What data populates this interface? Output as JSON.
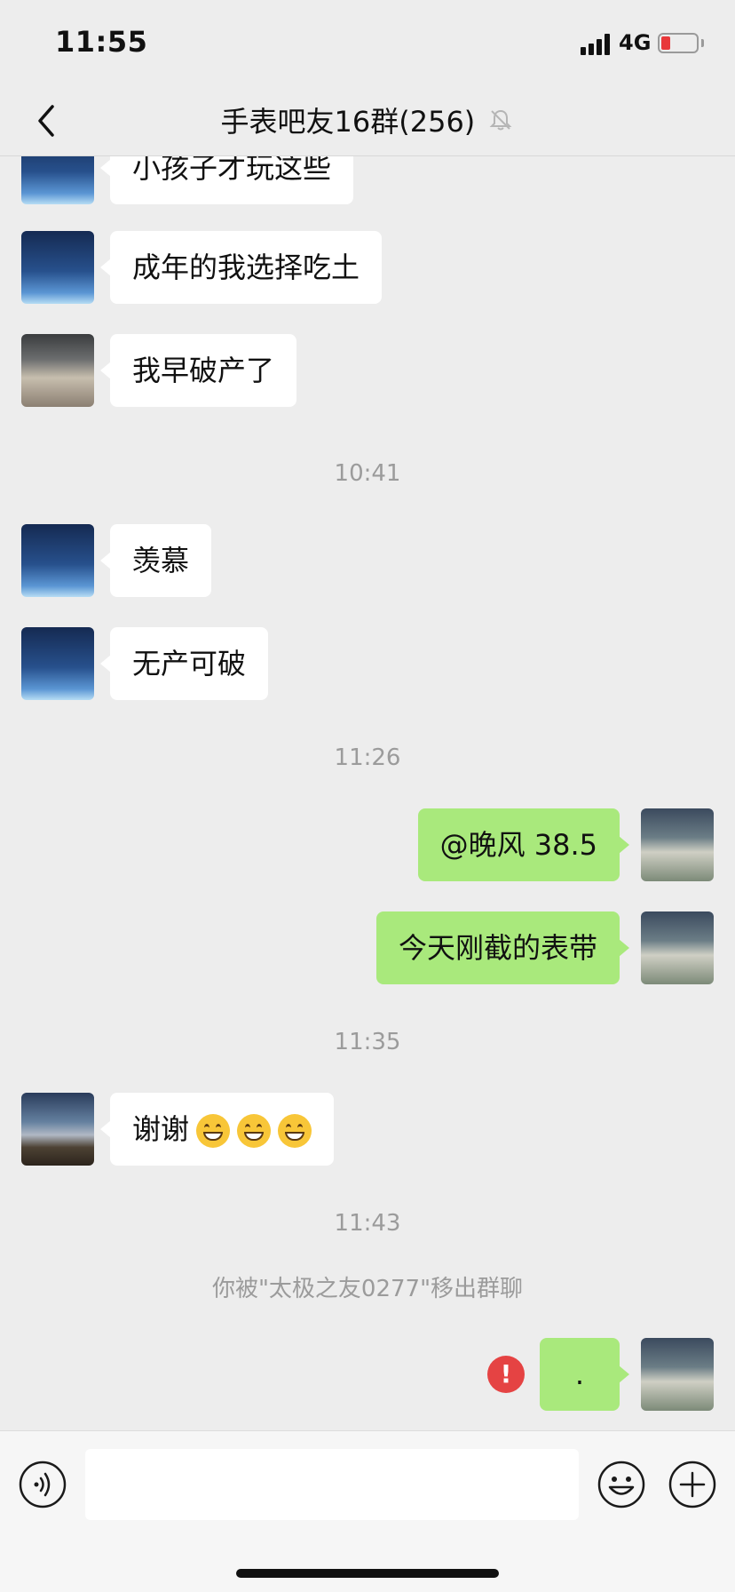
{
  "status": {
    "time": "11:55",
    "network": "4G"
  },
  "nav": {
    "title": "手表吧友16群(256)"
  },
  "messages": [
    {
      "text": "小孩子才玩这些"
    },
    {
      "text": "成年的我选择吃土"
    },
    {
      "text": "我早破产了"
    },
    {
      "time": "10:41"
    },
    {
      "text": "羡慕"
    },
    {
      "text": "无产可破"
    },
    {
      "time": "11:26"
    },
    {
      "text": "@晚风 38.5"
    },
    {
      "text": "今天刚截的表带"
    },
    {
      "time": "11:35"
    },
    {
      "text": "谢谢"
    },
    {
      "time": "11:43"
    },
    {
      "system": "你被\"太极之友0277\"移出群聊"
    },
    {
      "text": ".",
      "error_icon": "!"
    }
  ],
  "input": {
    "value": "",
    "placeholder": ""
  },
  "icons": {
    "back": "chevron-left-icon",
    "mute": "bell-off-icon",
    "voice": "voice-icon",
    "emoji": "smiley-icon",
    "more": "plus-icon",
    "error": "exclamation-icon",
    "grin": "grinning-emoji-icon"
  },
  "colors": {
    "background": "#ededed",
    "incoming_bubble": "#ffffff",
    "outgoing_bubble": "#a9e97c",
    "error": "#e54343"
  }
}
